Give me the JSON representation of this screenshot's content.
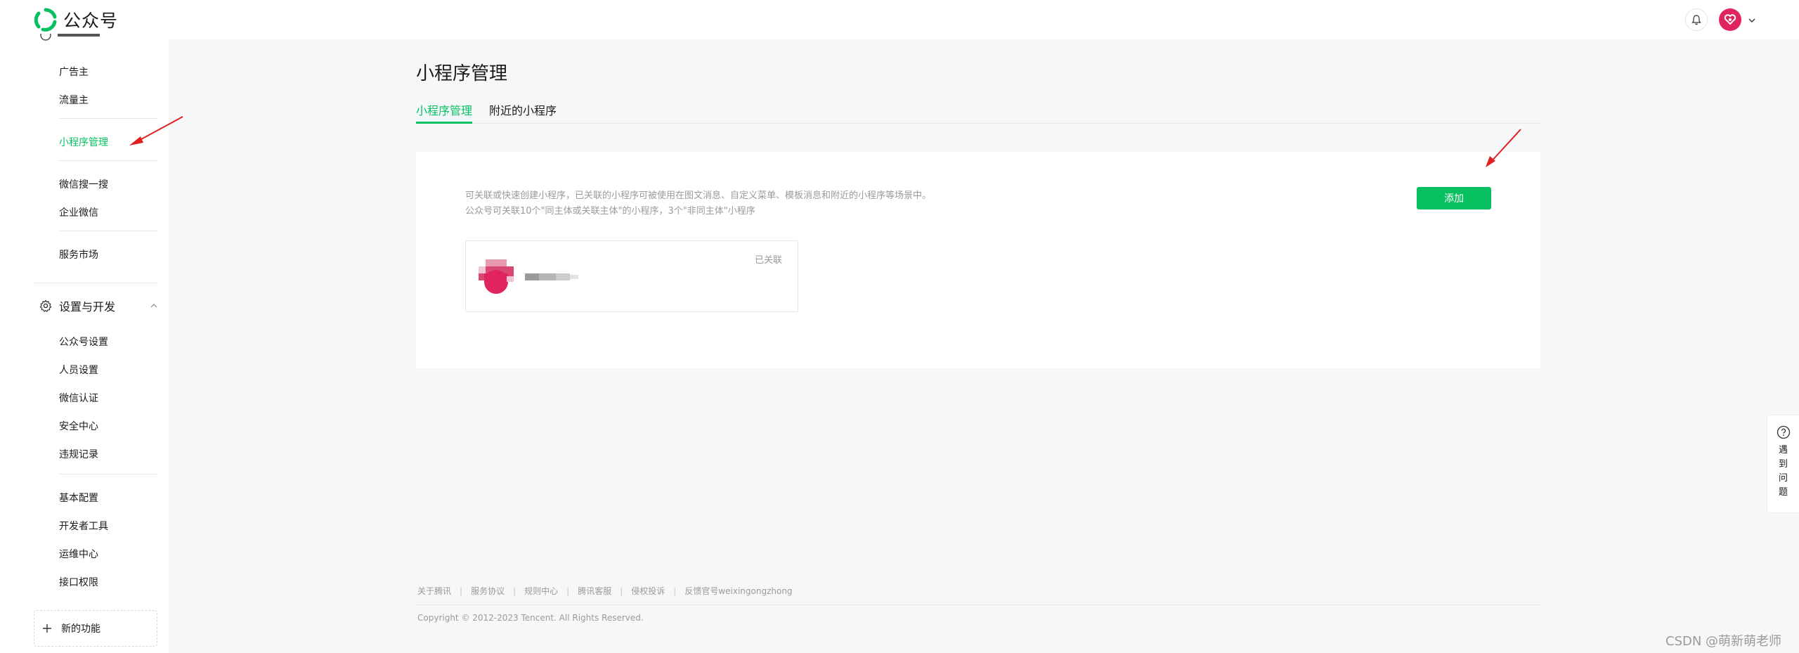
{
  "app": {
    "title": "公众号"
  },
  "header": {
    "bell_icon": "bell-icon",
    "avatar_icon": "heart-avatar-icon"
  },
  "sidebar": {
    "items_top": [
      {
        "label": "广告主"
      },
      {
        "label": "流量主"
      },
      {
        "label": "小程序管理",
        "active": true
      },
      {
        "label": "微信搜一搜"
      },
      {
        "label": "企业微信"
      },
      {
        "label": "服务市场"
      }
    ],
    "group": {
      "label": "设置与开发",
      "icon": "gear-icon",
      "expanded": true
    },
    "group_items_a": [
      {
        "label": "公众号设置"
      },
      {
        "label": "人员设置"
      },
      {
        "label": "微信认证"
      },
      {
        "label": "安全中心"
      },
      {
        "label": "违规记录"
      }
    ],
    "group_items_b": [
      {
        "label": "基本配置"
      },
      {
        "label": "开发者工具"
      },
      {
        "label": "运维中心"
      },
      {
        "label": "接口权限"
      }
    ],
    "new_feature": {
      "label": "新的功能"
    }
  },
  "main": {
    "title": "小程序管理",
    "tabs": [
      {
        "label": "小程序管理",
        "active": true
      },
      {
        "label": "附近的小程序",
        "active": false
      }
    ],
    "card": {
      "desc_line1": "可关联或快速创建小程序，已关联的小程序可被使用在图文消息、自定义菜单、模板消息和附近的小程序等场景中。",
      "desc_line2": "公众号可关联10个\"同主体或关联主体\"的小程序，3个\"非同主体\"小程序",
      "add_label": "添加",
      "mini_program": {
        "status": "已关联"
      }
    }
  },
  "footer": {
    "links": [
      "关于腾讯",
      "服务协议",
      "规则中心",
      "腾讯客服",
      "侵权投诉",
      "反馈官号weixingongzhong"
    ],
    "copyright": "Copyright © 2012-2023 Tencent. All Rights Reserved."
  },
  "help": {
    "label": "遇到问题",
    "icon": "question-circle-icon"
  },
  "watermark": "CSDN @萌新萌老师",
  "colors": {
    "brand": "#07c160",
    "avatar": "#e0245e",
    "annotation": "#e02020"
  }
}
